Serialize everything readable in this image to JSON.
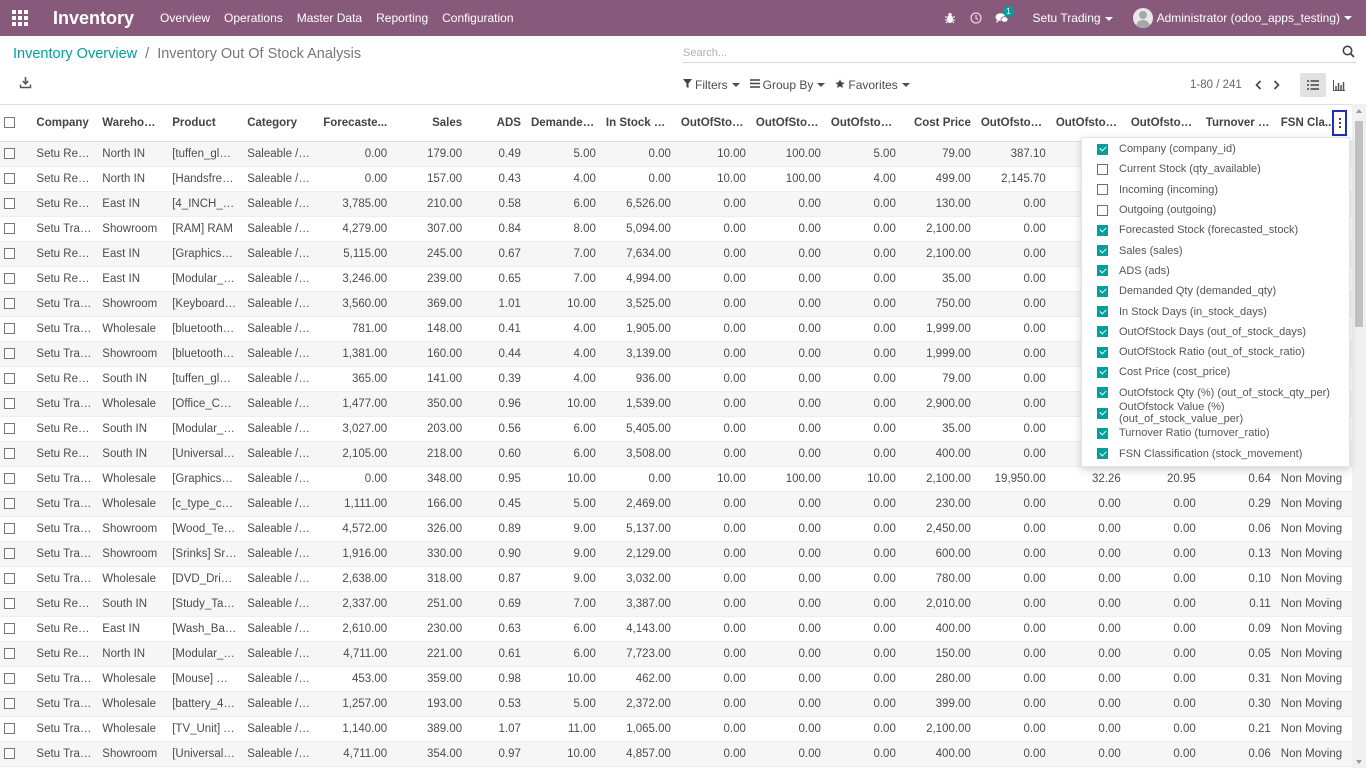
{
  "navbar": {
    "app_name": "Inventory",
    "menu": [
      "Overview",
      "Operations",
      "Master Data",
      "Reporting",
      "Configuration"
    ],
    "messages_count": "1",
    "company": "Setu Trading",
    "user": "Administrator (odoo_apps_testing)",
    "color": "#875a7b"
  },
  "breadcrumb": {
    "parent": "Inventory Overview",
    "separator": "/",
    "current": "Inventory Out Of Stock Analysis"
  },
  "search": {
    "placeholder": "Search..."
  },
  "filters": {
    "filters": "Filters",
    "group_by": "Group By",
    "favorites": "Favorites"
  },
  "pager": {
    "value": "1-80 / 241"
  },
  "table": {
    "columns": [
      "Company",
      "Warehouse",
      "Product",
      "Category",
      "Forecaste...",
      "Sales",
      "ADS",
      "Demanded...",
      "In Stock D...",
      "OutOfStoc...",
      "OutOfStoc...",
      "OutOfstoc...",
      "Cost Price",
      "OutOfstoc...",
      "OutOfstoc...",
      "OutOfstoc...",
      "Turnover R...",
      "FSN Cla..."
    ],
    "rows": [
      [
        "Setu Retail",
        "North IN",
        "[tuffen_glass...",
        "Saleable / M...",
        "0.00",
        "179.00",
        "0.49",
        "5.00",
        "0.00",
        "10.00",
        "100.00",
        "5.00",
        "79.00",
        "387.10",
        "",
        "",
        "",
        ""
      ],
      [
        "Setu Retail",
        "North IN",
        "[Handsfree] ...",
        "Saleable / M...",
        "0.00",
        "157.00",
        "0.43",
        "4.00",
        "0.00",
        "10.00",
        "100.00",
        "4.00",
        "499.00",
        "2,145.70",
        "",
        "",
        "",
        ""
      ],
      [
        "Setu Retail",
        "East IN",
        "[4_INCH_ON...",
        "Saleable / Pl...",
        "3,785.00",
        "210.00",
        "0.58",
        "6.00",
        "6,526.00",
        "0.00",
        "0.00",
        "0.00",
        "130.00",
        "0.00",
        "",
        "",
        "",
        ""
      ],
      [
        "Setu Trading",
        "Showroom",
        "[RAM] RAM",
        "Saleable / C...",
        "4,279.00",
        "307.00",
        "0.84",
        "8.00",
        "5,094.00",
        "0.00",
        "0.00",
        "0.00",
        "2,100.00",
        "0.00",
        "",
        "",
        "",
        ""
      ],
      [
        "Setu Retail",
        "East IN",
        "[Graphics_C...",
        "Saleable / C...",
        "5,115.00",
        "245.00",
        "0.67",
        "7.00",
        "7,634.00",
        "0.00",
        "0.00",
        "0.00",
        "2,100.00",
        "0.00",
        "",
        "",
        "",
        ""
      ],
      [
        "Setu Retail",
        "East IN",
        "[Modular_S...",
        "Saleable / El...",
        "3,246.00",
        "239.00",
        "0.65",
        "7.00",
        "4,994.00",
        "0.00",
        "0.00",
        "0.00",
        "35.00",
        "0.00",
        "",
        "",
        "",
        ""
      ],
      [
        "Setu Trading",
        "Showroom",
        "[Keyboard] K...",
        "Saleable / C...",
        "3,560.00",
        "369.00",
        "1.01",
        "10.00",
        "3,525.00",
        "0.00",
        "0.00",
        "0.00",
        "750.00",
        "0.00",
        "",
        "",
        "",
        ""
      ],
      [
        "Setu Trading",
        "Wholesale",
        "[bluetooth_h...",
        "Saleable / M...",
        "781.00",
        "148.00",
        "0.41",
        "4.00",
        "1,905.00",
        "0.00",
        "0.00",
        "0.00",
        "1,999.00",
        "0.00",
        "",
        "",
        "",
        ""
      ],
      [
        "Setu Trading",
        "Showroom",
        "[bluetooth_h...",
        "Saleable / M...",
        "1,381.00",
        "160.00",
        "0.44",
        "4.00",
        "3,139.00",
        "0.00",
        "0.00",
        "0.00",
        "1,999.00",
        "0.00",
        "",
        "",
        "",
        ""
      ],
      [
        "Setu Retail",
        "South IN",
        "[tuffen_glass...",
        "Saleable / M...",
        "365.00",
        "141.00",
        "0.39",
        "4.00",
        "936.00",
        "0.00",
        "0.00",
        "0.00",
        "79.00",
        "0.00",
        "",
        "",
        "",
        ""
      ],
      [
        "Setu Trading",
        "Wholesale",
        "[Office_Chair...",
        "Saleable / F...",
        "1,477.00",
        "350.00",
        "0.96",
        "10.00",
        "1,539.00",
        "0.00",
        "0.00",
        "0.00",
        "2,900.00",
        "0.00",
        "",
        "",
        "",
        ""
      ],
      [
        "Setu Retail",
        "South IN",
        "[Modular_S...",
        "Saleable / El...",
        "3,027.00",
        "203.00",
        "0.56",
        "6.00",
        "5,405.00",
        "0.00",
        "0.00",
        "0.00",
        "35.00",
        "0.00",
        "",
        "",
        "",
        ""
      ],
      [
        "Setu Retail",
        "South IN",
        "[Universal_C...",
        "Saleable / El...",
        "2,105.00",
        "218.00",
        "0.60",
        "6.00",
        "3,508.00",
        "0.00",
        "0.00",
        "0.00",
        "400.00",
        "0.00",
        "",
        "",
        "",
        ""
      ],
      [
        "Setu Trading",
        "Wholesale",
        "[Graphics_C...",
        "Saleable / C...",
        "0.00",
        "348.00",
        "0.95",
        "10.00",
        "0.00",
        "10.00",
        "100.00",
        "10.00",
        "2,100.00",
        "19,950.00",
        "32.26",
        "20.95",
        "0.64",
        "Non Moving"
      ],
      [
        "Setu Trading",
        "Wholesale",
        "[c_type_char...",
        "Saleable / M...",
        "1,111.00",
        "166.00",
        "0.45",
        "5.00",
        "2,469.00",
        "0.00",
        "0.00",
        "0.00",
        "230.00",
        "0.00",
        "0.00",
        "0.00",
        "0.29",
        "Non Moving"
      ],
      [
        "Setu Trading",
        "Showroom",
        "[Wood_Tem...",
        "Saleable / F...",
        "4,572.00",
        "326.00",
        "0.89",
        "9.00",
        "5,137.00",
        "0.00",
        "0.00",
        "0.00",
        "2,450.00",
        "0.00",
        "0.00",
        "0.00",
        "0.06",
        "Non Moving"
      ],
      [
        "Setu Trading",
        "Showroom",
        "[Srinks] Srinks",
        "Saleable / Pl...",
        "1,916.00",
        "330.00",
        "0.90",
        "9.00",
        "2,129.00",
        "0.00",
        "0.00",
        "0.00",
        "600.00",
        "0.00",
        "0.00",
        "0.00",
        "0.13",
        "Non Moving"
      ],
      [
        "Setu Trading",
        "Wholesale",
        "[DVD_Drive] ...",
        "Saleable / C...",
        "2,638.00",
        "318.00",
        "0.87",
        "9.00",
        "3,032.00",
        "0.00",
        "0.00",
        "0.00",
        "780.00",
        "0.00",
        "0.00",
        "0.00",
        "0.10",
        "Non Moving"
      ],
      [
        "Setu Retail",
        "South IN",
        "[Study_Table...",
        "Saleable / F...",
        "2,337.00",
        "251.00",
        "0.69",
        "7.00",
        "3,387.00",
        "0.00",
        "0.00",
        "0.00",
        "2,010.00",
        "0.00",
        "0.00",
        "0.00",
        "0.11",
        "Non Moving"
      ],
      [
        "Setu Retail",
        "East IN",
        "[Wash_Basin...",
        "Saleable / Pl...",
        "2,610.00",
        "230.00",
        "0.63",
        "6.00",
        "4,143.00",
        "0.00",
        "0.00",
        "0.00",
        "400.00",
        "0.00",
        "0.00",
        "0.00",
        "0.09",
        "Non Moving"
      ],
      [
        "Setu Retail",
        "North IN",
        "[Modular_S...",
        "Saleable / El...",
        "4,711.00",
        "221.00",
        "0.61",
        "6.00",
        "7,723.00",
        "0.00",
        "0.00",
        "0.00",
        "150.00",
        "0.00",
        "0.00",
        "0.00",
        "0.05",
        "Non Moving"
      ],
      [
        "Setu Trading",
        "Wholesale",
        "[Mouse] Mo...",
        "Saleable / C...",
        "453.00",
        "359.00",
        "0.98",
        "10.00",
        "462.00",
        "0.00",
        "0.00",
        "0.00",
        "280.00",
        "0.00",
        "0.00",
        "0.00",
        "0.31",
        "Non Moving"
      ],
      [
        "Setu Trading",
        "Wholesale",
        "[battery_400...",
        "Saleable / M...",
        "1,257.00",
        "193.00",
        "0.53",
        "5.00",
        "2,372.00",
        "0.00",
        "0.00",
        "0.00",
        "399.00",
        "0.00",
        "0.00",
        "0.00",
        "0.30",
        "Non Moving"
      ],
      [
        "Setu Trading",
        "Wholesale",
        "[TV_Unit] TV ...",
        "Saleable / F...",
        "1,140.00",
        "389.00",
        "1.07",
        "11.00",
        "1,065.00",
        "0.00",
        "0.00",
        "0.00",
        "2,100.00",
        "0.00",
        "0.00",
        "0.00",
        "0.21",
        "Non Moving"
      ],
      [
        "Setu Trading",
        "Showroom",
        "[Universal_C...",
        "Saleable / El...",
        "4,711.00",
        "354.00",
        "0.97",
        "10.00",
        "4,857.00",
        "0.00",
        "0.00",
        "0.00",
        "400.00",
        "0.00",
        "0.00",
        "0.00",
        "0.06",
        "Non Moving"
      ]
    ]
  },
  "optional_columns": [
    {
      "label": "Company (company_id)",
      "checked": true
    },
    {
      "label": "Current Stock (qty_available)",
      "checked": false
    },
    {
      "label": "Incoming (incoming)",
      "checked": false
    },
    {
      "label": "Outgoing (outgoing)",
      "checked": false
    },
    {
      "label": "Forecasted Stock (forecasted_stock)",
      "checked": true
    },
    {
      "label": "Sales (sales)",
      "checked": true
    },
    {
      "label": "ADS (ads)",
      "checked": true
    },
    {
      "label": "Demanded Qty (demanded_qty)",
      "checked": true
    },
    {
      "label": "In Stock Days (in_stock_days)",
      "checked": true
    },
    {
      "label": "OutOfStock Days (out_of_stock_days)",
      "checked": true
    },
    {
      "label": "OutOfStock Ratio (out_of_stock_ratio)",
      "checked": true
    },
    {
      "label": "Cost Price (cost_price)",
      "checked": true
    },
    {
      "label": "OutOfstock Qty (%) (out_of_stock_qty_per)",
      "checked": true
    },
    {
      "label": "OutOfstock Value (%) (out_of_stock_value_per)",
      "checked": true
    },
    {
      "label": "Turnover Ratio (turnover_ratio)",
      "checked": true
    },
    {
      "label": "FSN Classification (stock_movement)",
      "checked": true
    }
  ],
  "colors": {
    "accent": "#00a09d",
    "brand": "#875a7b"
  },
  "icons": [
    "apps-grid-icon",
    "bug-icon",
    "clock-icon",
    "chat-icon",
    "search-icon",
    "download-icon",
    "filter-icon",
    "group-by-icon",
    "star-icon",
    "list-view-icon",
    "graph-view-icon",
    "optional-columns-icon"
  ]
}
